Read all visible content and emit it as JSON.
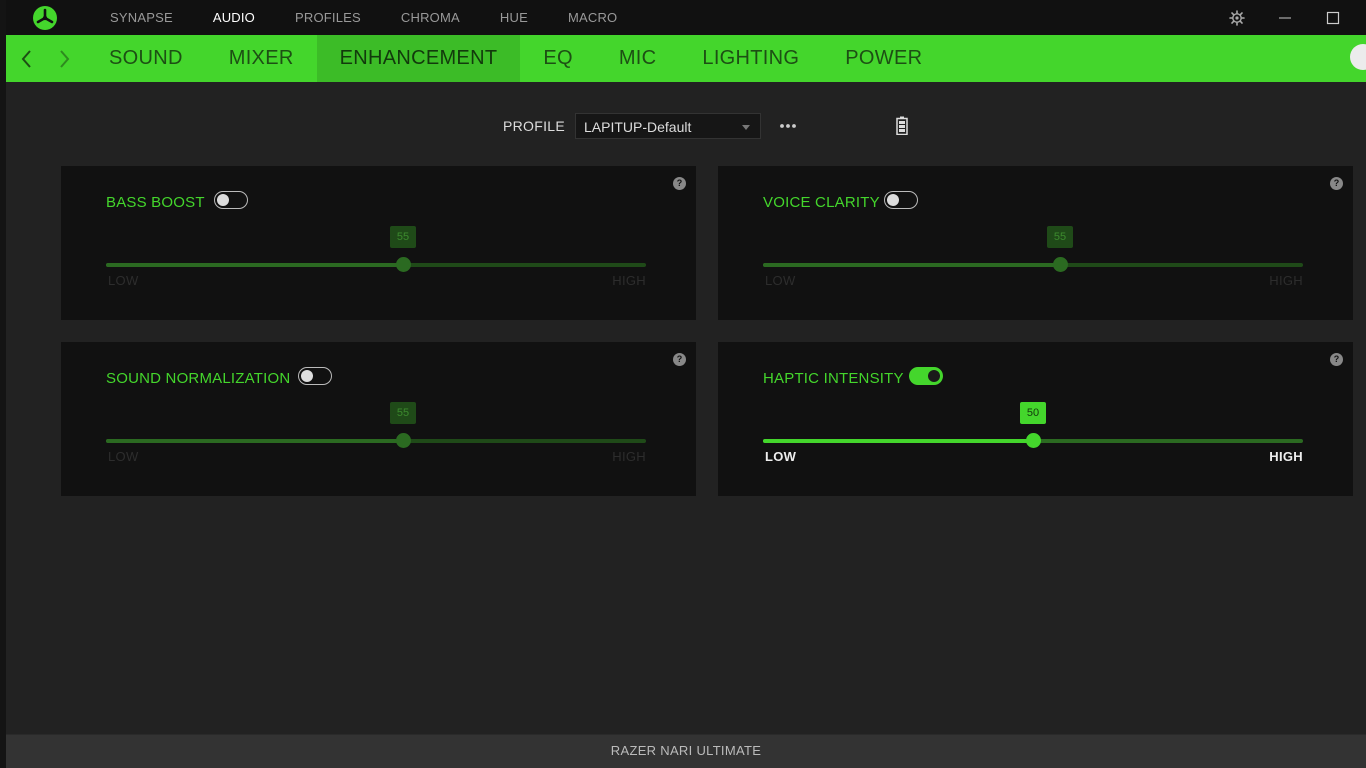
{
  "topnav": [
    "SYNAPSE",
    "AUDIO",
    "PROFILES",
    "CHROMA",
    "HUE",
    "MACRO"
  ],
  "active_topnav": "AUDIO",
  "tabs": [
    "SOUND",
    "MIXER",
    "ENHANCEMENT",
    "EQ",
    "MIC",
    "LIGHTING",
    "POWER"
  ],
  "active_tab": "ENHANCEMENT",
  "profile": {
    "label": "PROFILE",
    "value": "LAPITUP-Default"
  },
  "cards": {
    "bass_boost": {
      "title": "BASS BOOST",
      "enabled": false,
      "value": 55,
      "low": "LOW",
      "high": "HIGH",
      "help": "?"
    },
    "voice_clarity": {
      "title": "VOICE CLARITY",
      "enabled": false,
      "value": 55,
      "low": "LOW",
      "high": "HIGH",
      "help": "?"
    },
    "sound_normalization": {
      "title": "SOUND NORMALIZATION",
      "enabled": false,
      "value": 55,
      "low": "LOW",
      "high": "HIGH",
      "help": "?"
    },
    "haptic_intensity": {
      "title": "HAPTIC INTENSITY",
      "enabled": true,
      "value": 50,
      "low": "LOW",
      "high": "HIGH",
      "help": "?"
    }
  },
  "footer": {
    "device": "RAZER NARI ULTIMATE"
  },
  "colors": {
    "accent": "#44d62c",
    "accent_dark": "#3cbc27",
    "panel": "#111111",
    "background": "#222222"
  },
  "icons": {
    "logo": "razer-logo-icon",
    "settings": "gear-icon",
    "minimize": "minimize-icon",
    "maximize": "maximize-icon",
    "back": "chevron-left-icon",
    "forward": "chevron-right-icon",
    "more": "more-dots-icon",
    "battery": "battery-icon"
  }
}
